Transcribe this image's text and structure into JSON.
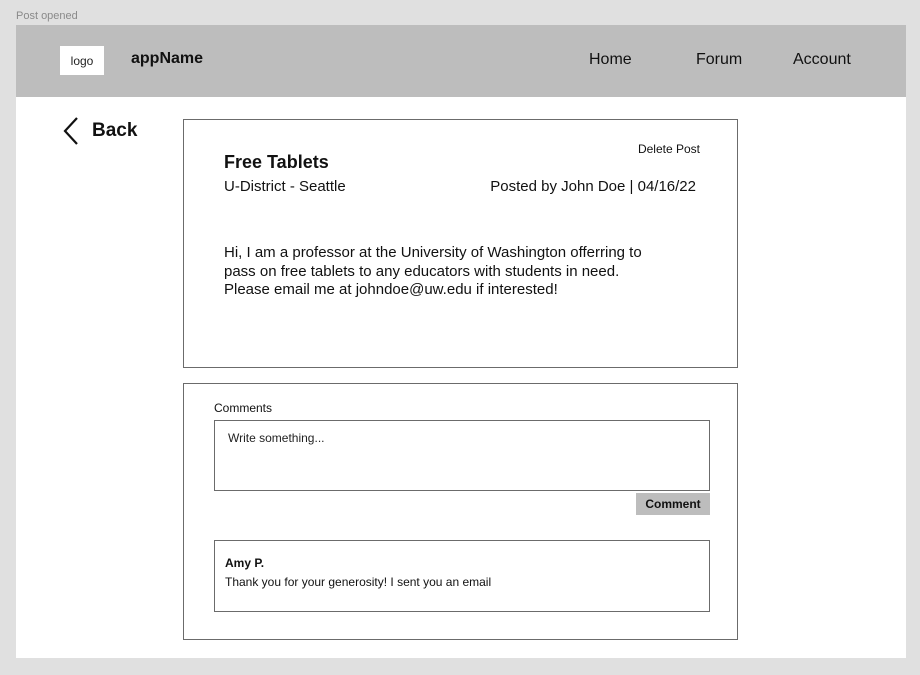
{
  "frame_label": "Post opened",
  "navbar": {
    "logo": "logo",
    "app_name": "appName",
    "links": {
      "home": "Home",
      "forum": "Forum",
      "account": "Account"
    }
  },
  "back": {
    "label": "Back",
    "icon": "chevron-left-icon"
  },
  "post": {
    "delete_label": "Delete Post",
    "title": "Free Tablets",
    "location": "U-District - Seattle",
    "meta": "Posted by John Doe | 04/16/22",
    "body": "Hi, I am a professor at the University of Washington offerring to pass on free tablets to any educators with students in need. Please email me at johndoe@uw.edu if interested!"
  },
  "comments": {
    "heading": "Comments",
    "input_placeholder": "Write something...",
    "submit_label": "Comment",
    "items": [
      {
        "author": "Amy P.",
        "text": "Thank you for your generosity! I sent you an email"
      }
    ]
  },
  "colors": {
    "navbar": "#bdbdbd",
    "background": "#e0e0e0",
    "card_border": "#6b6b6b",
    "button": "#bdbdbd"
  }
}
